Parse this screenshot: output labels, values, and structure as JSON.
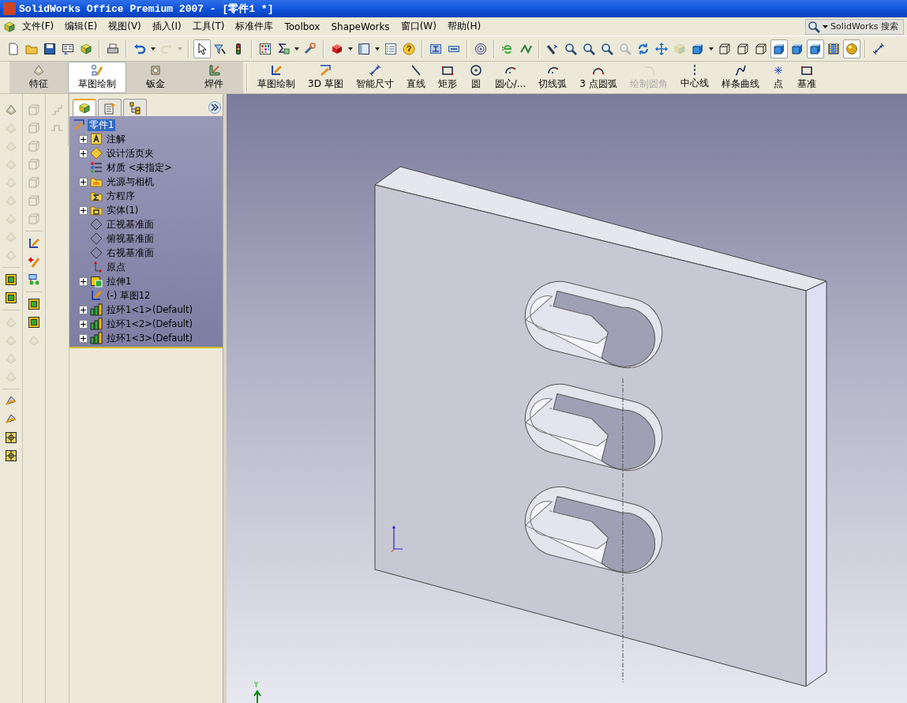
{
  "title_bar": {
    "title": "SolidWorks Office Premium 2007 - [零件1 *]"
  },
  "menu_bar": {
    "items": [
      {
        "label": "文件(F)"
      },
      {
        "label": "编辑(E)"
      },
      {
        "label": "视图(V)"
      },
      {
        "label": "插入(I)"
      },
      {
        "label": "工具(T)"
      },
      {
        "label": "标准件库"
      },
      {
        "label": "Toolbox"
      },
      {
        "label": "ShapeWorks"
      },
      {
        "label": "窗口(W)"
      },
      {
        "label": "帮助(H)"
      }
    ],
    "search": {
      "label": "SolidWorks 搜索"
    }
  },
  "standard_toolbar": [
    [
      {
        "kind": "page",
        "pressed": false,
        "disabled": false
      },
      {
        "kind": "folder",
        "pressed": false,
        "disabled": false
      },
      {
        "kind": "disk",
        "pressed": false,
        "disabled": false
      },
      {
        "kind": "panel",
        "pressed": false,
        "disabled": false
      },
      {
        "kind": "cube",
        "pressed": false,
        "disabled": false
      }
    ],
    [
      {
        "kind": "printer",
        "pressed": false,
        "disabled": false
      }
    ],
    [
      {
        "kind": "undo",
        "pressed": false,
        "disabled": false
      },
      {
        "kind": "caret",
        "pressed": false,
        "disabled": false
      },
      {
        "kind": "redo",
        "pressed": false,
        "disabled": true
      },
      {
        "kind": "caret",
        "pressed": false,
        "disabled": true
      }
    ],
    [
      {
        "kind": "cursor",
        "pressed": true,
        "disabled": false
      },
      {
        "kind": "funnel",
        "pressed": false,
        "disabled": false
      },
      {
        "kind": "traffic",
        "pressed": false,
        "disabled": false
      }
    ],
    [
      {
        "kind": "grid",
        "pressed": false,
        "disabled": false
      },
      {
        "kind": "sigma",
        "pressed": false,
        "disabled": false
      },
      {
        "kind": "caret",
        "pressed": false,
        "disabled": false
      },
      {
        "kind": "wrench",
        "pressed": false,
        "disabled": false
      }
    ],
    [
      {
        "kind": "redbox",
        "pressed": false,
        "disabled": false
      },
      {
        "kind": "caret",
        "pressed": false,
        "disabled": false
      },
      {
        "kind": "window",
        "pressed": false,
        "disabled": false
      },
      {
        "kind": "caret",
        "pressed": false,
        "disabled": false
      },
      {
        "kind": "list",
        "pressed": false,
        "disabled": false
      },
      {
        "kind": "help",
        "pressed": false,
        "disabled": false
      }
    ],
    [
      {
        "kind": "pin",
        "pressed": false,
        "disabled": false
      },
      {
        "kind": "tag",
        "pressed": false,
        "disabled": false
      }
    ],
    [
      {
        "kind": "target",
        "pressed": false,
        "disabled": false
      }
    ],
    [
      {
        "kind": "globe",
        "pressed": false,
        "disabled": false
      },
      {
        "kind": "link",
        "pressed": false,
        "disabled": false
      }
    ],
    [
      {
        "kind": "view-back",
        "pressed": false,
        "disabled": false
      },
      {
        "kind": "zoom",
        "pressed": false,
        "disabled": false
      },
      {
        "kind": "zoom",
        "pressed": false,
        "disabled": false
      },
      {
        "kind": "zoom",
        "pressed": false,
        "disabled": false
      },
      {
        "kind": "zoom",
        "pressed": false,
        "disabled": true
      },
      {
        "kind": "rotate",
        "pressed": false,
        "disabled": false
      },
      {
        "kind": "pan",
        "pressed": false,
        "disabled": false
      },
      {
        "kind": "cube",
        "pressed": false,
        "disabled": true
      },
      {
        "kind": "shaded-cube",
        "pressed": false,
        "disabled": false
      },
      {
        "kind": "caret",
        "pressed": false,
        "disabled": false
      },
      {
        "kind": "wire-cube",
        "pressed": false,
        "disabled": false
      },
      {
        "kind": "wire-cube",
        "pressed": false,
        "disabled": false
      },
      {
        "kind": "wire-cube",
        "pressed": false,
        "disabled": false
      },
      {
        "kind": "shaded-cube",
        "pressed": true,
        "disabled": false
      },
      {
        "kind": "shaded-cube",
        "pressed": false,
        "disabled": false
      },
      {
        "kind": "shaded-cube",
        "pressed": true,
        "disabled": false
      },
      {
        "kind": "film",
        "pressed": false,
        "disabled": false
      },
      {
        "kind": "sphere",
        "pressed": true,
        "disabled": false
      }
    ],
    [
      {
        "kind": "dimension",
        "pressed": false,
        "disabled": false
      }
    ]
  ],
  "command_manager": {
    "tabs": [
      {
        "label": "特征",
        "selected": false
      },
      {
        "label": "草图绘制",
        "selected": true
      },
      {
        "label": "钣金",
        "selected": false
      },
      {
        "label": "焊件",
        "selected": false
      }
    ],
    "commands": [
      {
        "label": "草图绘制",
        "disabled": false
      },
      {
        "label": "3D 草图",
        "disabled": false
      },
      {
        "label": "智能尺寸",
        "disabled": false
      },
      {
        "label": "直线",
        "disabled": false
      },
      {
        "label": "矩形",
        "disabled": false
      },
      {
        "label": "圆",
        "disabled": false
      },
      {
        "label": "圆心/...",
        "disabled": false
      },
      {
        "label": "切线弧",
        "disabled": false
      },
      {
        "label": "3 点圆弧",
        "disabled": false
      },
      {
        "label": "绘制圆角",
        "disabled": true
      },
      {
        "label": "中心线",
        "disabled": false
      },
      {
        "label": "样条曲线",
        "disabled": false
      },
      {
        "label": "点",
        "disabled": false
      },
      {
        "label": "基准",
        "disabled": false
      }
    ]
  },
  "side_toolbars": [
    [
      [
        {
          "kind": "feature",
          "disabled": false
        },
        {
          "kind": "feature",
          "disabled": true
        },
        {
          "kind": "feature",
          "disabled": true
        },
        {
          "kind": "feature",
          "disabled": true
        },
        {
          "kind": "feature",
          "disabled": true
        },
        {
          "kind": "feature",
          "disabled": true
        },
        {
          "kind": "feature",
          "disabled": true
        },
        {
          "kind": "feature",
          "disabled": true
        },
        {
          "kind": "feature",
          "disabled": true
        }
      ],
      [
        {
          "kind": "box",
          "disabled": false
        },
        {
          "kind": "box",
          "disabled": false
        }
      ],
      [
        {
          "kind": "feature",
          "disabled": true
        },
        {
          "kind": "feature",
          "disabled": true
        },
        {
          "kind": "feature",
          "disabled": true
        },
        {
          "kind": "feature",
          "disabled": true
        }
      ],
      [
        {
          "kind": "wedge",
          "disabled": false
        },
        {
          "kind": "wedge",
          "disabled": false
        },
        {
          "kind": "tile",
          "disabled": false
        },
        {
          "kind": "tile",
          "disabled": false
        }
      ]
    ],
    [
      [
        {
          "kind": "wire-cube",
          "disabled": true
        },
        {
          "kind": "wire-cube",
          "disabled": true
        },
        {
          "kind": "wire-cube",
          "disabled": true
        },
        {
          "kind": "wire-cube",
          "disabled": true
        },
        {
          "kind": "wire-cube",
          "disabled": true
        },
        {
          "kind": "wire-cube",
          "disabled": true
        },
        {
          "kind": "wire-cube",
          "disabled": true
        }
      ],
      [
        {
          "kind": "sketch",
          "disabled": false
        },
        {
          "kind": "pencil",
          "disabled": false
        },
        {
          "kind": "blocks",
          "disabled": false
        }
      ],
      [
        {
          "kind": "box",
          "disabled": false
        },
        {
          "kind": "box",
          "disabled": false
        },
        {
          "kind": "feature",
          "disabled": true
        }
      ]
    ],
    [
      [
        {
          "kind": "steps",
          "disabled": true
        },
        {
          "kind": "pulse",
          "disabled": true
        }
      ]
    ]
  ],
  "feature_tree": {
    "tabs": [
      {
        "selected": true
      },
      {
        "selected": false
      },
      {
        "selected": false
      }
    ],
    "root": {
      "label": "零件1",
      "selected": true
    },
    "items": [
      {
        "label": "注解",
        "kind": "annotation",
        "expandable": true
      },
      {
        "label": "设计活页夹",
        "kind": "binder",
        "expandable": true
      },
      {
        "label": "材质 <未指定>",
        "kind": "material",
        "expandable": false
      },
      {
        "label": "光源与相机",
        "kind": "lights",
        "expandable": true
      },
      {
        "label": "方程序",
        "kind": "equations",
        "expandable": false
      },
      {
        "label": "实体(1)",
        "kind": "solid",
        "expandable": true
      },
      {
        "label": "正视基准面",
        "kind": "plane",
        "expandable": false
      },
      {
        "label": "俯视基准面",
        "kind": "plane",
        "expandable": false
      },
      {
        "label": "右视基准面",
        "kind": "plane",
        "expandable": false
      },
      {
        "label": "原点",
        "kind": "origin",
        "expandable": false
      },
      {
        "label": "拉伸1",
        "kind": "extrude",
        "expandable": true
      },
      {
        "label": "(-) 草图12",
        "kind": "sketch",
        "expandable": false
      },
      {
        "label": "拉环1<1>(Default)",
        "kind": "ring",
        "expandable": true
      },
      {
        "label": "拉环1<2>(Default)",
        "kind": "ring",
        "expandable": true
      },
      {
        "label": "拉环1<3>(Default)",
        "kind": "ring",
        "expandable": true
      }
    ]
  },
  "graphics": {
    "y_axis_label": "Y"
  }
}
